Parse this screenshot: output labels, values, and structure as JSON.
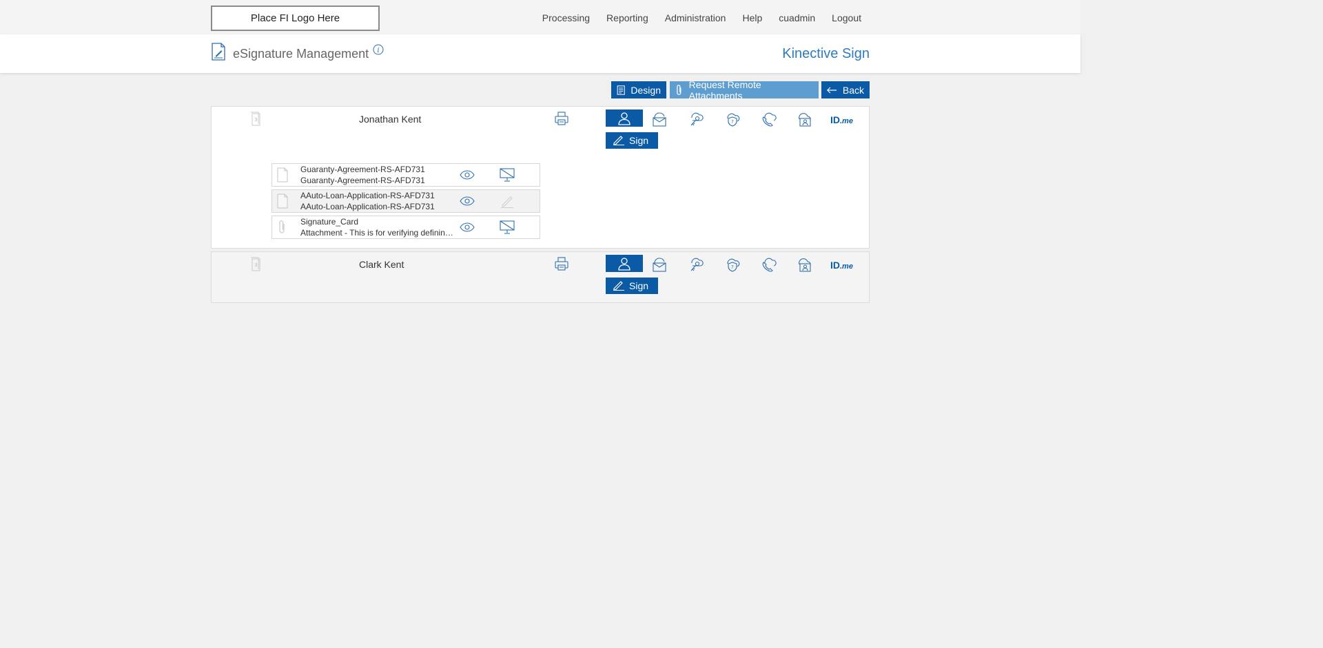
{
  "header": {
    "logo_text": "Place FI Logo Here",
    "nav": [
      "Processing",
      "Reporting",
      "Administration",
      "Help",
      "cuadmin",
      "Logout"
    ]
  },
  "title_band": {
    "title": "eSignature Management",
    "brand": "Kinective Sign"
  },
  "actions": {
    "design": "Design",
    "request_attachments": "Request Remote Attachments",
    "back": "Back"
  },
  "signers": [
    {
      "name": "Jonathan Kent",
      "sign_label": "Sign",
      "idme_label": "ID",
      "idme_suffix": ".me",
      "documents": [
        {
          "line1": "Guaranty-Agreement-RS-AFD731",
          "line2": "Guaranty-Agreement-RS-AFD731",
          "type": "document",
          "action": "screen-off"
        },
        {
          "line1": "AAuto-Loan-Application-RS-AFD731",
          "line2": "AAuto-Loan-Application-RS-AFD731",
          "type": "document",
          "action": "sign-disabled"
        },
        {
          "line1": "Signature_Card",
          "line2": "Attachment - This is for verifying defining a...",
          "type": "attachment",
          "action": "screen-off"
        }
      ]
    },
    {
      "name": "Clark Kent",
      "sign_label": "Sign",
      "idme_label": "ID",
      "idme_suffix": ".me",
      "documents": []
    }
  ],
  "colors": {
    "primary": "#0a5aa6",
    "primary_light": "#5d9dd0",
    "brand_text": "#2e7bbf",
    "icon": "#2e6fae"
  },
  "icons": {
    "auth_methods": [
      "in-person-icon",
      "email-icon",
      "key-icon",
      "security-question-icon",
      "phone-icon",
      "cloud-id-icon",
      "idme-logo"
    ]
  }
}
